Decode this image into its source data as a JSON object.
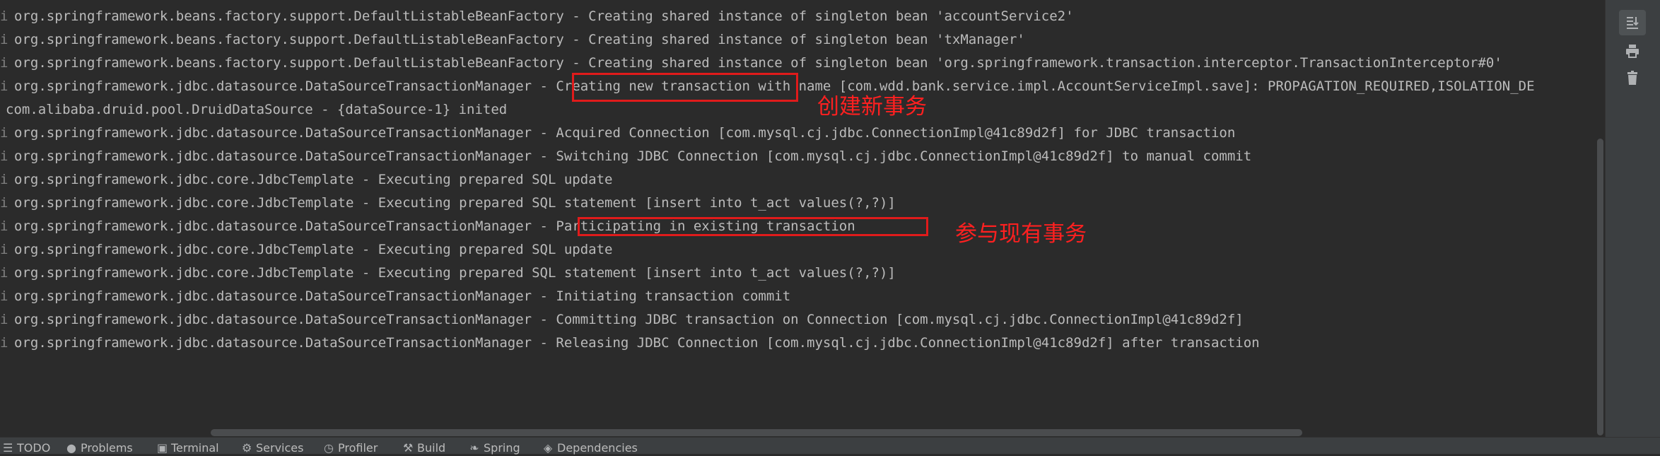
{
  "console": {
    "gutter_mark": "i",
    "lines": [
      "org.springframework.beans.factory.support.DefaultListableBeanFactory - Creating shared instance of singleton bean 'accountService2'",
      "org.springframework.beans.factory.support.DefaultListableBeanFactory - Creating shared instance of singleton bean 'txManager'",
      "org.springframework.beans.factory.support.DefaultListableBeanFactory - Creating shared instance of singleton bean 'org.springframework.transaction.interceptor.TransactionInterceptor#0'",
      "org.springframework.jdbc.datasource.DataSourceTransactionManager - Creating new transaction with name [com.wdd.bank.service.impl.AccountServiceImpl.save]: PROPAGATION_REQUIRED,ISOLATION_DE",
      "com.alibaba.druid.pool.DruidDataSource - {dataSource-1} inited",
      "org.springframework.jdbc.datasource.DataSourceTransactionManager - Acquired Connection [com.mysql.cj.jdbc.ConnectionImpl@41c89d2f] for JDBC transaction",
      "org.springframework.jdbc.datasource.DataSourceTransactionManager - Switching JDBC Connection [com.mysql.cj.jdbc.ConnectionImpl@41c89d2f] to manual commit",
      "org.springframework.jdbc.core.JdbcTemplate - Executing prepared SQL update",
      "org.springframework.jdbc.core.JdbcTemplate - Executing prepared SQL statement [insert into t_act values(?,?)]",
      "org.springframework.jdbc.datasource.DataSourceTransactionManager - Participating in existing transaction",
      "org.springframework.jdbc.core.JdbcTemplate - Executing prepared SQL update",
      "org.springframework.jdbc.core.JdbcTemplate - Executing prepared SQL statement [insert into t_act values(?,?)]",
      "org.springframework.jdbc.datasource.DataSourceTransactionManager - Initiating transaction commit",
      "org.springframework.jdbc.datasource.DataSourceTransactionManager - Committing JDBC transaction on Connection [com.mysql.cj.jdbc.ConnectionImpl@41c89d2f]",
      "org.springframework.jdbc.datasource.DataSourceTransactionManager - Releasing JDBC Connection [com.mysql.cj.jdbc.ConnectionImpl@41c89d2f] after transaction"
    ]
  },
  "annotations": {
    "create_new_transaction": "创建新事务",
    "participate_existing_transaction": "参与现有事务"
  },
  "colors": {
    "background": "#2b2b2b",
    "text": "#bbbbbb",
    "highlight": "#e01b1b"
  },
  "toolbar": {
    "icons": [
      "more-icon",
      "scroll-to-end-icon",
      "print-icon",
      "clear-all-icon"
    ]
  },
  "tool_windows": [
    {
      "icon": "todo-icon",
      "label": "TODO"
    },
    {
      "icon": "problems-icon",
      "label": "Problems"
    },
    {
      "icon": "terminal-icon",
      "label": "Terminal"
    },
    {
      "icon": "services-icon",
      "label": "Services"
    },
    {
      "icon": "profiler-icon",
      "label": "Profiler"
    },
    {
      "icon": "build-icon",
      "label": "Build"
    },
    {
      "icon": "spring-icon",
      "label": "Spring"
    },
    {
      "icon": "dependencies-icon",
      "label": "Dependencies"
    }
  ]
}
